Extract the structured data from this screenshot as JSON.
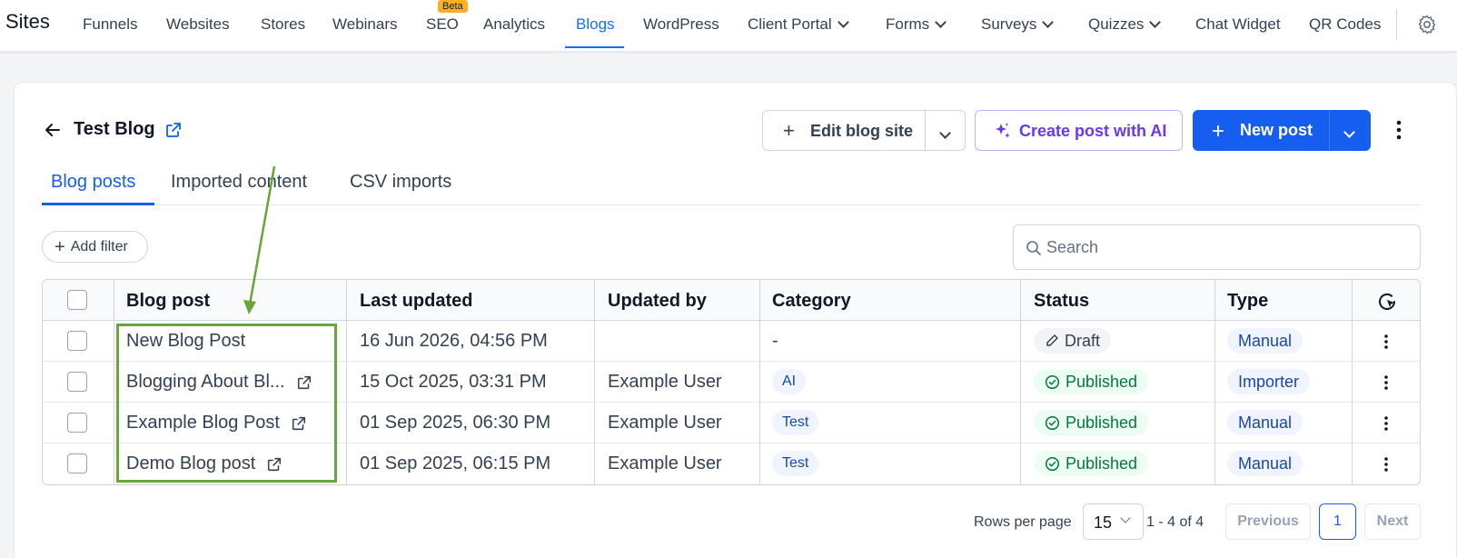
{
  "nav": {
    "brand": "Sites",
    "beta_badge": "Beta",
    "items": [
      {
        "label": "Funnels"
      },
      {
        "label": "Websites"
      },
      {
        "label": "Stores"
      },
      {
        "label": "Webinars"
      },
      {
        "label": "SEO"
      },
      {
        "label": "Analytics"
      },
      {
        "label": "Blogs",
        "active": true
      },
      {
        "label": "WordPress"
      },
      {
        "label": "Client Portal"
      },
      {
        "label": "Forms"
      },
      {
        "label": "Surveys"
      },
      {
        "label": "Quizzes"
      },
      {
        "label": "Chat Widget"
      },
      {
        "label": "QR Codes"
      }
    ]
  },
  "header": {
    "title": "Test Blog",
    "edit_blog_site": "Edit blog site",
    "create_post_ai": "Create post with AI",
    "new_post": "New post"
  },
  "tabs": [
    {
      "label": "Blog posts",
      "active": true
    },
    {
      "label": "Imported content"
    },
    {
      "label": "CSV imports"
    }
  ],
  "toolbar": {
    "add_filter": "Add filter",
    "search_placeholder": "Search"
  },
  "table": {
    "headers": [
      "Blog post",
      "Last updated",
      "Updated by",
      "Category",
      "Status",
      "Type"
    ],
    "rows": [
      {
        "title": "New Blog Post",
        "updated": "16 Jun 2026, 04:56 PM",
        "by": "",
        "category": "-",
        "status": "Draft",
        "type": "Manual"
      },
      {
        "title": "Blogging About Bl...",
        "updated": "15 Oct 2025, 03:31 PM",
        "by": "Example User",
        "category": "AI",
        "status": "Published",
        "type": "Importer"
      },
      {
        "title": "Example Blog Post",
        "updated": "01 Sep 2025, 06:30 PM",
        "by": "Example User",
        "category": "Test",
        "status": "Published",
        "type": "Manual"
      },
      {
        "title": "Demo Blog post",
        "updated": "01 Sep 2025, 06:15 PM",
        "by": "Example User",
        "category": "Test",
        "status": "Published",
        "type": "Manual"
      }
    ]
  },
  "pagination": {
    "rows_per_page_label": "Rows per page",
    "rows_per_page": "15",
    "range": "1 - 4 of 4",
    "previous": "Previous",
    "current_page": "1",
    "next": "Next"
  },
  "colors": {
    "primary": "#155eef",
    "ai_accent": "#6938ef",
    "success": "#067647",
    "annotation": "#6aa538"
  }
}
